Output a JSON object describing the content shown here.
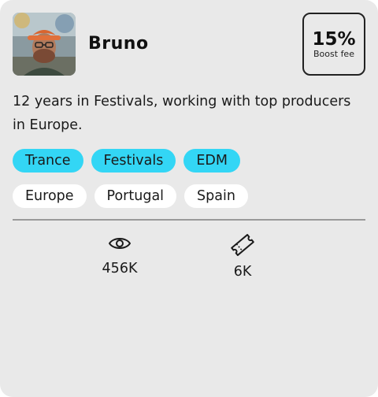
{
  "profile": {
    "name": "Bruno",
    "bio": "12 years in Festivals, working with top producers in Europe."
  },
  "fee": {
    "value": "15%",
    "label": "Boost fee"
  },
  "genres": [
    "Trance",
    "Festivals",
    "EDM"
  ],
  "regions": [
    "Europe",
    "Portugal",
    "Spain"
  ],
  "stats": {
    "views": "456K",
    "tickets": "6K"
  },
  "icons": {
    "views": "eye-icon",
    "tickets": "ticket-icon"
  },
  "colors": {
    "card_background": "#e9e9e9",
    "genre_tag": "#33d6f5",
    "region_tag": "#ffffff"
  }
}
